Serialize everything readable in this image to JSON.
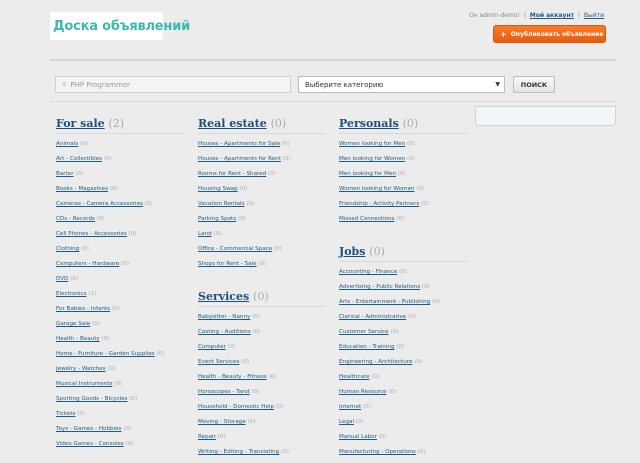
{
  "header": {
    "logo_text": "Доска объявлений",
    "user_text": "Он admin-demo!",
    "my_account": "Мой аккаунт",
    "logout": "Выйти",
    "post_button": "Опубликовать объявление"
  },
  "search": {
    "placeholder": "PHP Programmer",
    "category_placeholder": "Выберите категорию",
    "button": "ПОИСК"
  },
  "columns": [
    {
      "sections": [
        {
          "title": "For sale",
          "count": "(2)",
          "items": [
            {
              "label": "Animals",
              "count": "(0)"
            },
            {
              "label": "Art - Collectibles",
              "count": "(0)"
            },
            {
              "label": "Barter",
              "count": "(0)"
            },
            {
              "label": "Books - Magazines",
              "count": "(0)"
            },
            {
              "label": "Cameras - Camera Accessories",
              "count": "(0)"
            },
            {
              "label": "CDs - Records",
              "count": "(0)"
            },
            {
              "label": "Cell Phones - Accessories",
              "count": "(0)"
            },
            {
              "label": "Clothing",
              "count": "(0)"
            },
            {
              "label": "Computers - Hardware",
              "count": "(0)"
            },
            {
              "label": "DVD",
              "count": "(0)"
            },
            {
              "label": "Electronics",
              "count": "(1)"
            },
            {
              "label": "For Babies - Infants",
              "count": "(0)"
            },
            {
              "label": "Garage Sale",
              "count": "(0)"
            },
            {
              "label": "Health - Beauty",
              "count": "(0)"
            },
            {
              "label": "Home - Furniture - Garden Supplies",
              "count": "(0)"
            },
            {
              "label": "Jewelry - Watches",
              "count": "(0)"
            },
            {
              "label": "Musical Instruments",
              "count": "(0)"
            },
            {
              "label": "Sporting Goods - Bicycles",
              "count": "(0)"
            },
            {
              "label": "Tickets",
              "count": "(0)"
            },
            {
              "label": "Toys - Games - Hobbies",
              "count": "(0)"
            },
            {
              "label": "Video Games - Consoles",
              "count": "(0)"
            }
          ]
        }
      ]
    },
    {
      "sections": [
        {
          "title": "Real estate",
          "count": "(0)",
          "items": [
            {
              "label": "Houses - Apartments for Sale",
              "count": "(0)"
            },
            {
              "label": "Houses - Apartments for Rent",
              "count": "(0)"
            },
            {
              "label": "Rooms for Rent - Shared",
              "count": "(0)"
            },
            {
              "label": "Housing Swap",
              "count": "(0)"
            },
            {
              "label": "Vacation Rentals",
              "count": "(0)"
            },
            {
              "label": "Parking Spots",
              "count": "(0)"
            },
            {
              "label": "Land",
              "count": "(0)"
            },
            {
              "label": "Office - Commercial Space",
              "count": "(0)"
            },
            {
              "label": "Shops for Rent - Sale",
              "count": "(0)"
            }
          ]
        },
        {
          "title": "Services",
          "count": "(0)",
          "items": [
            {
              "label": "Babysitter - Nanny",
              "count": "(0)"
            },
            {
              "label": "Casting - Auditions",
              "count": "(0)"
            },
            {
              "label": "Computer",
              "count": "(0)"
            },
            {
              "label": "Event Services",
              "count": "(0)"
            },
            {
              "label": "Health - Beauty - Fitness",
              "count": "(0)"
            },
            {
              "label": "Horoscopes - Tarot",
              "count": "(0)"
            },
            {
              "label": "Household - Domestic Help",
              "count": "(0)"
            },
            {
              "label": "Moving - Storage",
              "count": "(0)"
            },
            {
              "label": "Repair",
              "count": "(0)"
            },
            {
              "label": "Writing - Editing - Translating",
              "count": "(0)"
            }
          ]
        }
      ]
    },
    {
      "sections": [
        {
          "title": "Personals",
          "count": "(0)",
          "items": [
            {
              "label": "Women looking for Men",
              "count": "(0)"
            },
            {
              "label": "Men looking for Women",
              "count": "(0)"
            },
            {
              "label": "Men looking for Men",
              "count": "(0)"
            },
            {
              "label": "Women looking for Women",
              "count": "(0)"
            },
            {
              "label": "Friendship - Activity Partners",
              "count": "(0)"
            },
            {
              "label": "Missed Connections",
              "count": "(0)"
            }
          ]
        },
        {
          "title": "Jobs",
          "count": "(0)",
          "items": [
            {
              "label": "Accounting - Finance",
              "count": "(0)"
            },
            {
              "label": "Advertising - Public Relations",
              "count": "(0)"
            },
            {
              "label": "Arts - Entertainment - Publishing",
              "count": "(0)"
            },
            {
              "label": "Clerical - Administrative",
              "count": "(0)"
            },
            {
              "label": "Customer Service",
              "count": "(0)"
            },
            {
              "label": "Education - Training",
              "count": "(0)"
            },
            {
              "label": "Engineering - Architecture",
              "count": "(0)"
            },
            {
              "label": "Healthcare",
              "count": "(0)"
            },
            {
              "label": "Human Resource",
              "count": "(0)"
            },
            {
              "label": "Internet",
              "count": "(0)"
            },
            {
              "label": "Legal",
              "count": "(0)"
            },
            {
              "label": "Manual Labor",
              "count": "(0)"
            },
            {
              "label": "Manufacturing - Operations",
              "count": "(0)"
            }
          ]
        }
      ]
    }
  ]
}
